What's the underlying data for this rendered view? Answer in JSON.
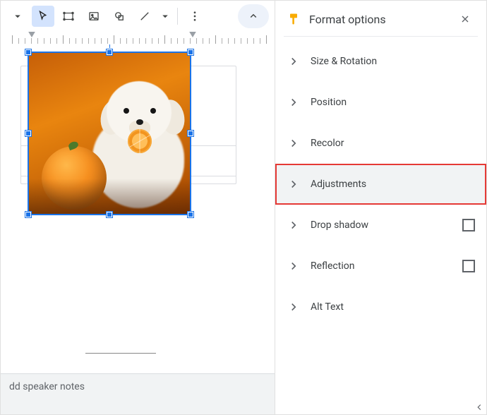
{
  "panel": {
    "title": "Format options",
    "options": [
      {
        "label": "Size & Rotation",
        "checkbox": false
      },
      {
        "label": "Position",
        "checkbox": false
      },
      {
        "label": "Recolor",
        "checkbox": false
      },
      {
        "label": "Adjustments",
        "checkbox": false
      },
      {
        "label": "Drop shadow",
        "checkbox": true
      },
      {
        "label": "Reflection",
        "checkbox": true
      },
      {
        "label": "Alt Text",
        "checkbox": false
      }
    ],
    "highlighted_index": 3
  },
  "notes_placeholder": "dd speaker notes"
}
